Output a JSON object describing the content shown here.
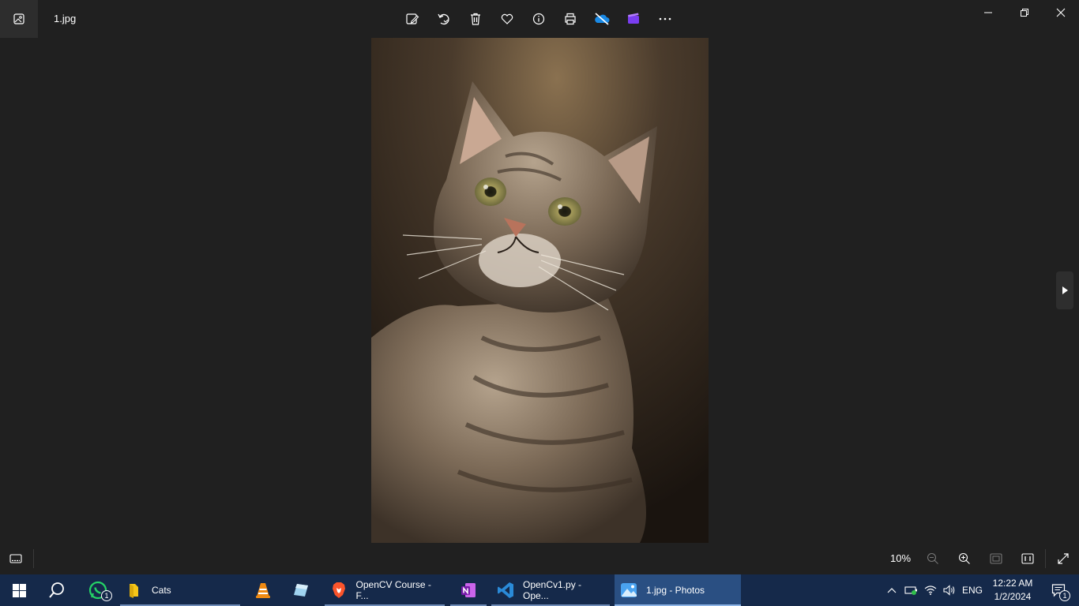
{
  "window": {
    "title": "1.jpg",
    "toolbar": [
      {
        "name": "edit-image-icon"
      },
      {
        "name": "rotate-icon"
      },
      {
        "name": "delete-icon"
      },
      {
        "name": "favorite-heart-icon"
      },
      {
        "name": "file-info-icon"
      },
      {
        "name": "print-icon"
      },
      {
        "name": "onedrive-icon"
      },
      {
        "name": "clipchamp-icon"
      },
      {
        "name": "more-icon"
      }
    ],
    "controls": [
      "minimize-icon",
      "restore-icon",
      "close-icon"
    ]
  },
  "photo": {
    "subject": "cat",
    "next_button_icon": "chevron-right-icon"
  },
  "bottombar": {
    "zoom_level": "10%"
  },
  "taskbar": {
    "apps": [
      {
        "label": "Cats",
        "icon": "folder-icon"
      },
      {
        "label": "OpenCV Course - F...",
        "icon": "brave-icon"
      },
      {
        "label": "OpenCv1.py - Ope...",
        "icon": "vscode-icon"
      },
      {
        "label": "1.jpg - Photos",
        "icon": "photos-icon"
      }
    ],
    "whatsapp_badge": "1",
    "language": "ENG",
    "time": "12:22 AM",
    "date": "1/2/2024",
    "notifications_badge": "1"
  },
  "colors": {
    "background": "#202020",
    "taskbar": "#15294a",
    "active_taskbar_item": "#2a4f82"
  }
}
